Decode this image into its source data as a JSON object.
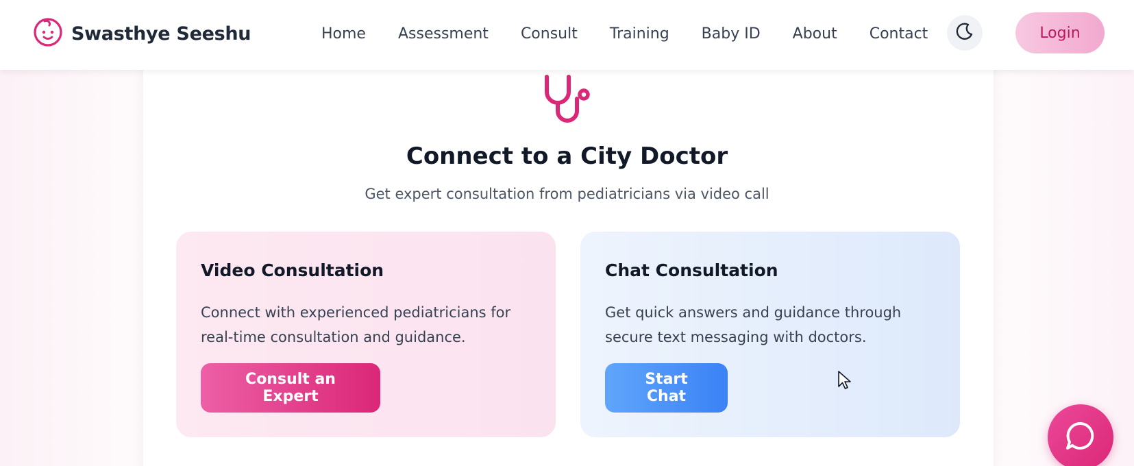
{
  "brand": {
    "name": "Swasthye Seeshu",
    "icon": "baby-face-icon"
  },
  "nav": {
    "items": [
      {
        "label": "Home"
      },
      {
        "label": "Assessment"
      },
      {
        "label": "Consult"
      },
      {
        "label": "Training"
      },
      {
        "label": "Baby ID"
      },
      {
        "label": "About"
      },
      {
        "label": "Contact"
      }
    ],
    "theme_icon": "moon-icon",
    "login_label": "Login"
  },
  "hero": {
    "icon": "stethoscope-icon",
    "title": "Connect to a City Doctor",
    "subtitle": "Get expert consultation from pediatricians via video call"
  },
  "options": [
    {
      "title": "Video Consultation",
      "desc": "Connect with experienced pediatricians for real-time consultation and guidance.",
      "button": "Consult an Expert"
    },
    {
      "title": "Chat Consultation",
      "desc": "Get quick answers and guidance through secure text messaging with doctors.",
      "button": "Start Chat"
    }
  ],
  "fab": {
    "icon": "chat-bubble-icon"
  },
  "colors": {
    "accent_pink": "#db2777",
    "accent_blue": "#3b82f6",
    "login_bg": "#f5b8d8"
  }
}
